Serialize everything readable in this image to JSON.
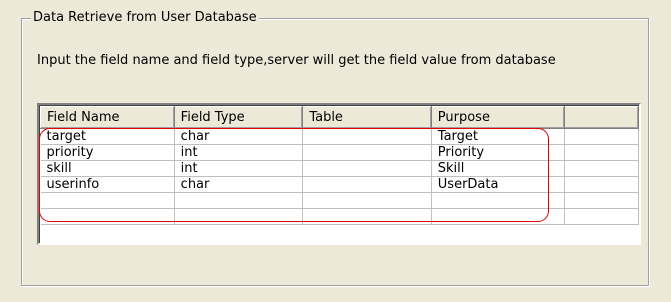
{
  "group": {
    "title": "Data Retrieve from User Database",
    "description": "Input the field name and field type,server will get the field value from database"
  },
  "list": {
    "columns": [
      "Field Name",
      "Field Type",
      "Table",
      "Purpose",
      ""
    ],
    "rows": [
      [
        "target",
        "char",
        "",
        "Target",
        ""
      ],
      [
        "priority",
        "int",
        "",
        "Priority",
        ""
      ],
      [
        "skill",
        "int",
        "",
        "Skill",
        ""
      ],
      [
        "userinfo",
        "char",
        "",
        "UserData",
        ""
      ],
      [
        "",
        "",
        "",
        "",
        ""
      ],
      [
        "",
        "",
        "",
        "",
        ""
      ]
    ]
  },
  "colors": {
    "background": "#ece9d8",
    "highlight": "#e00000"
  }
}
